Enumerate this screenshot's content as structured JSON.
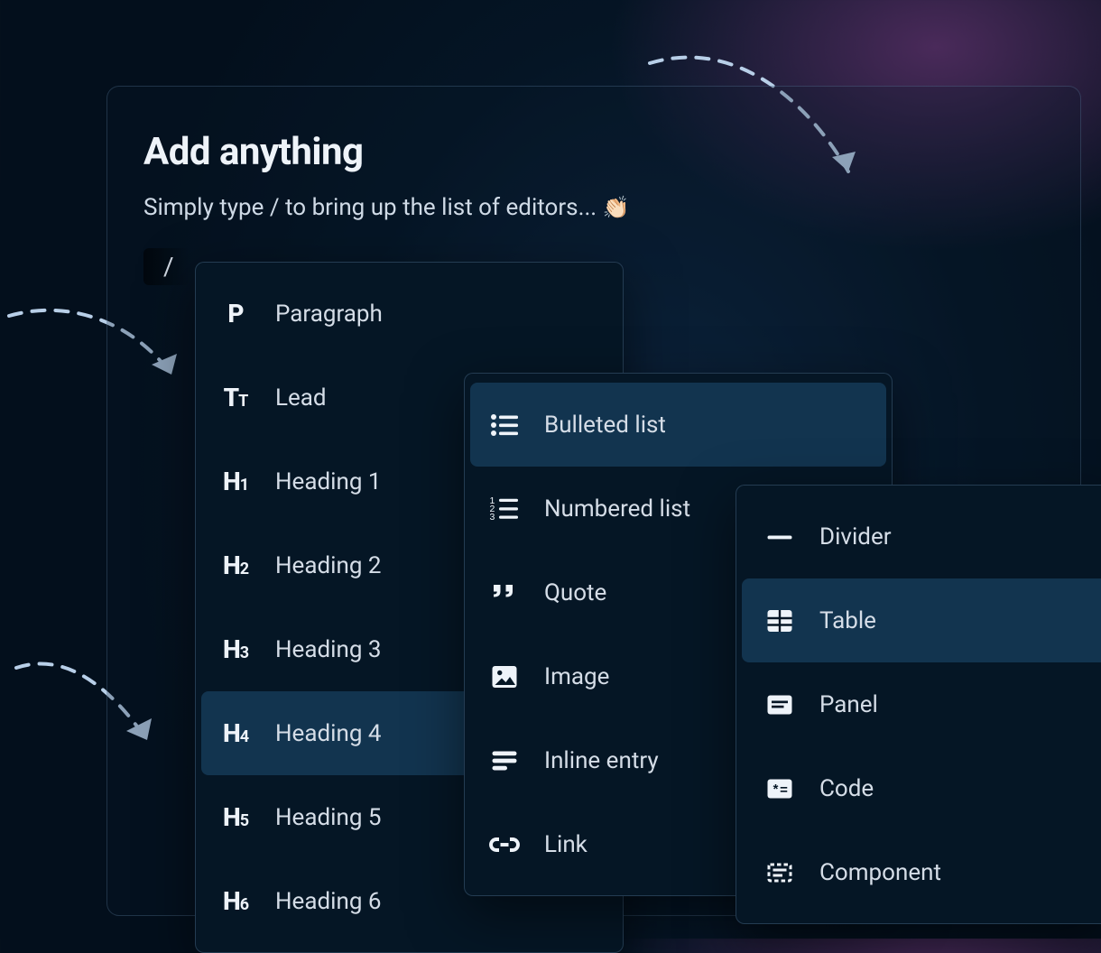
{
  "panel": {
    "title": "Add anything",
    "subtitle": "Simply type / to bring up the list of editors... ",
    "emoji": "👏🏻",
    "slash": "/"
  },
  "menu1": {
    "items": [
      {
        "icon": "paragraph",
        "label": "Paragraph",
        "highlight": false
      },
      {
        "icon": "lead",
        "label": "Lead",
        "highlight": false
      },
      {
        "icon": "h1",
        "label": "Heading 1",
        "highlight": false
      },
      {
        "icon": "h2",
        "label": "Heading 2",
        "highlight": false
      },
      {
        "icon": "h3",
        "label": "Heading 3",
        "highlight": false
      },
      {
        "icon": "h4",
        "label": "Heading 4",
        "highlight": true
      },
      {
        "icon": "h5",
        "label": "Heading 5",
        "highlight": false
      },
      {
        "icon": "h6",
        "label": "Heading 6",
        "highlight": false
      }
    ]
  },
  "menu2": {
    "items": [
      {
        "icon": "bulleted-list",
        "label": "Bulleted list",
        "highlight": true
      },
      {
        "icon": "numbered-list",
        "label": "Numbered list",
        "highlight": false
      },
      {
        "icon": "quote",
        "label": "Quote",
        "highlight": false
      },
      {
        "icon": "image",
        "label": "Image",
        "highlight": false
      },
      {
        "icon": "inline-entry",
        "label": "Inline entry",
        "highlight": false
      },
      {
        "icon": "link",
        "label": "Link",
        "highlight": false
      }
    ]
  },
  "menu3": {
    "items": [
      {
        "icon": "divider",
        "label": "Divider",
        "highlight": false
      },
      {
        "icon": "table",
        "label": "Table",
        "highlight": true
      },
      {
        "icon": "panel",
        "label": "Panel",
        "highlight": false
      },
      {
        "icon": "code",
        "label": "Code",
        "highlight": false
      },
      {
        "icon": "component",
        "label": "Component",
        "highlight": false
      }
    ]
  }
}
